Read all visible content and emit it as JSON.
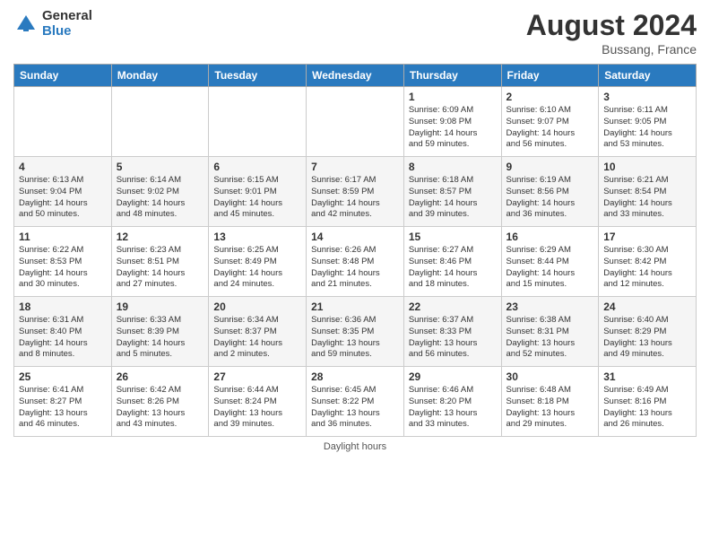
{
  "header": {
    "logo_general": "General",
    "logo_blue": "Blue",
    "title": "August 2024",
    "location": "Bussang, France"
  },
  "days_of_week": [
    "Sunday",
    "Monday",
    "Tuesday",
    "Wednesday",
    "Thursday",
    "Friday",
    "Saturday"
  ],
  "weeks": [
    [
      {
        "day": "",
        "info": ""
      },
      {
        "day": "",
        "info": ""
      },
      {
        "day": "",
        "info": ""
      },
      {
        "day": "",
        "info": ""
      },
      {
        "day": "1",
        "info": "Sunrise: 6:09 AM\nSunset: 9:08 PM\nDaylight: 14 hours\nand 59 minutes."
      },
      {
        "day": "2",
        "info": "Sunrise: 6:10 AM\nSunset: 9:07 PM\nDaylight: 14 hours\nand 56 minutes."
      },
      {
        "day": "3",
        "info": "Sunrise: 6:11 AM\nSunset: 9:05 PM\nDaylight: 14 hours\nand 53 minutes."
      }
    ],
    [
      {
        "day": "4",
        "info": "Sunrise: 6:13 AM\nSunset: 9:04 PM\nDaylight: 14 hours\nand 50 minutes."
      },
      {
        "day": "5",
        "info": "Sunrise: 6:14 AM\nSunset: 9:02 PM\nDaylight: 14 hours\nand 48 minutes."
      },
      {
        "day": "6",
        "info": "Sunrise: 6:15 AM\nSunset: 9:01 PM\nDaylight: 14 hours\nand 45 minutes."
      },
      {
        "day": "7",
        "info": "Sunrise: 6:17 AM\nSunset: 8:59 PM\nDaylight: 14 hours\nand 42 minutes."
      },
      {
        "day": "8",
        "info": "Sunrise: 6:18 AM\nSunset: 8:57 PM\nDaylight: 14 hours\nand 39 minutes."
      },
      {
        "day": "9",
        "info": "Sunrise: 6:19 AM\nSunset: 8:56 PM\nDaylight: 14 hours\nand 36 minutes."
      },
      {
        "day": "10",
        "info": "Sunrise: 6:21 AM\nSunset: 8:54 PM\nDaylight: 14 hours\nand 33 minutes."
      }
    ],
    [
      {
        "day": "11",
        "info": "Sunrise: 6:22 AM\nSunset: 8:53 PM\nDaylight: 14 hours\nand 30 minutes."
      },
      {
        "day": "12",
        "info": "Sunrise: 6:23 AM\nSunset: 8:51 PM\nDaylight: 14 hours\nand 27 minutes."
      },
      {
        "day": "13",
        "info": "Sunrise: 6:25 AM\nSunset: 8:49 PM\nDaylight: 14 hours\nand 24 minutes."
      },
      {
        "day": "14",
        "info": "Sunrise: 6:26 AM\nSunset: 8:48 PM\nDaylight: 14 hours\nand 21 minutes."
      },
      {
        "day": "15",
        "info": "Sunrise: 6:27 AM\nSunset: 8:46 PM\nDaylight: 14 hours\nand 18 minutes."
      },
      {
        "day": "16",
        "info": "Sunrise: 6:29 AM\nSunset: 8:44 PM\nDaylight: 14 hours\nand 15 minutes."
      },
      {
        "day": "17",
        "info": "Sunrise: 6:30 AM\nSunset: 8:42 PM\nDaylight: 14 hours\nand 12 minutes."
      }
    ],
    [
      {
        "day": "18",
        "info": "Sunrise: 6:31 AM\nSunset: 8:40 PM\nDaylight: 14 hours\nand 8 minutes."
      },
      {
        "day": "19",
        "info": "Sunrise: 6:33 AM\nSunset: 8:39 PM\nDaylight: 14 hours\nand 5 minutes."
      },
      {
        "day": "20",
        "info": "Sunrise: 6:34 AM\nSunset: 8:37 PM\nDaylight: 14 hours\nand 2 minutes."
      },
      {
        "day": "21",
        "info": "Sunrise: 6:36 AM\nSunset: 8:35 PM\nDaylight: 13 hours\nand 59 minutes."
      },
      {
        "day": "22",
        "info": "Sunrise: 6:37 AM\nSunset: 8:33 PM\nDaylight: 13 hours\nand 56 minutes."
      },
      {
        "day": "23",
        "info": "Sunrise: 6:38 AM\nSunset: 8:31 PM\nDaylight: 13 hours\nand 52 minutes."
      },
      {
        "day": "24",
        "info": "Sunrise: 6:40 AM\nSunset: 8:29 PM\nDaylight: 13 hours\nand 49 minutes."
      }
    ],
    [
      {
        "day": "25",
        "info": "Sunrise: 6:41 AM\nSunset: 8:27 PM\nDaylight: 13 hours\nand 46 minutes."
      },
      {
        "day": "26",
        "info": "Sunrise: 6:42 AM\nSunset: 8:26 PM\nDaylight: 13 hours\nand 43 minutes."
      },
      {
        "day": "27",
        "info": "Sunrise: 6:44 AM\nSunset: 8:24 PM\nDaylight: 13 hours\nand 39 minutes."
      },
      {
        "day": "28",
        "info": "Sunrise: 6:45 AM\nSunset: 8:22 PM\nDaylight: 13 hours\nand 36 minutes."
      },
      {
        "day": "29",
        "info": "Sunrise: 6:46 AM\nSunset: 8:20 PM\nDaylight: 13 hours\nand 33 minutes."
      },
      {
        "day": "30",
        "info": "Sunrise: 6:48 AM\nSunset: 8:18 PM\nDaylight: 13 hours\nand 29 minutes."
      },
      {
        "day": "31",
        "info": "Sunrise: 6:49 AM\nSunset: 8:16 PM\nDaylight: 13 hours\nand 26 minutes."
      }
    ]
  ],
  "footer": "Daylight hours"
}
